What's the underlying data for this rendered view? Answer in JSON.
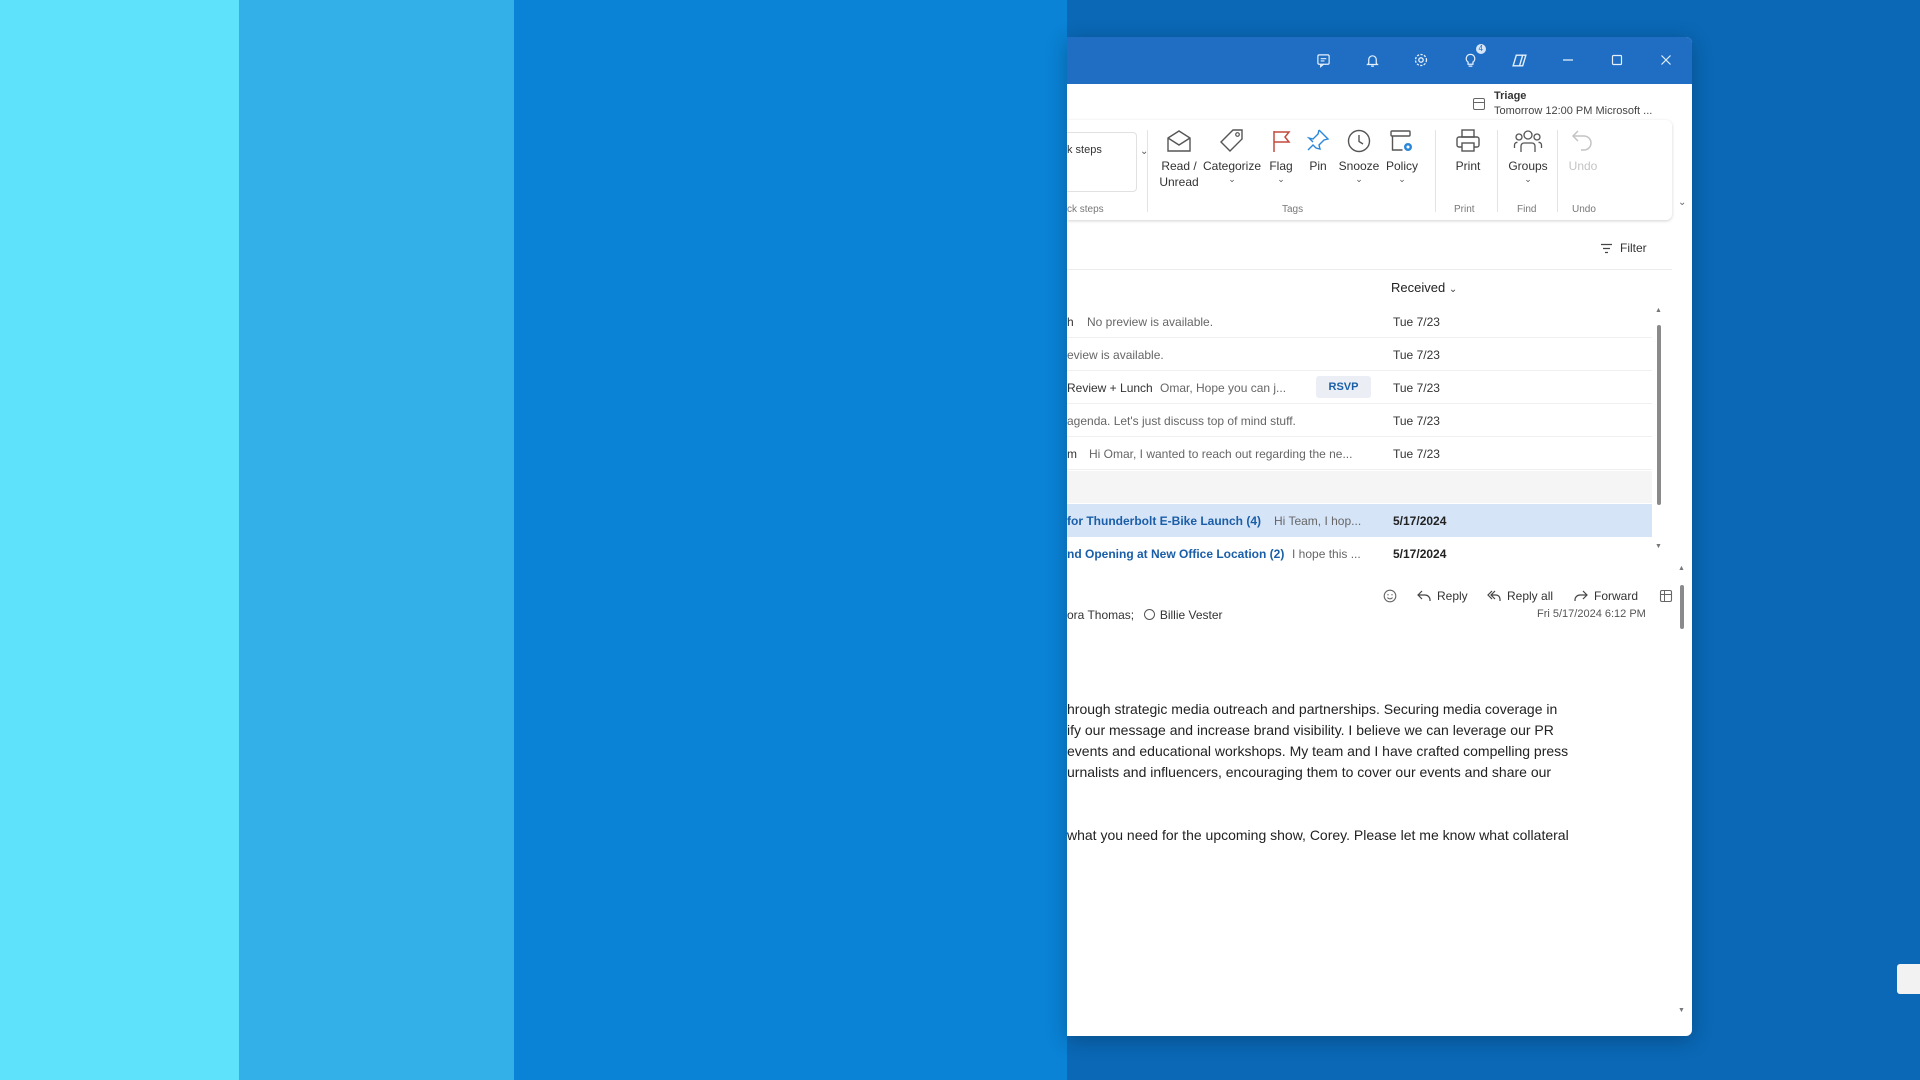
{
  "titlebar": {
    "icons": [
      "notepad-icon",
      "bell-icon",
      "gear-icon",
      "lightbulb-icon",
      "copilot-icon",
      "minimize-icon",
      "maximize-icon",
      "close-icon"
    ],
    "tips_badge": "4"
  },
  "triage": {
    "title": "Triage",
    "detail": "Tomorrow 12:00 PM Microsoft ..."
  },
  "ribbon": {
    "quick_steps_label": "k steps",
    "quick_steps_group": "ck steps",
    "read_unread_line1": "Read /",
    "read_unread_line2": "Unread",
    "categorize": "Categorize",
    "flag": "Flag",
    "pin": "Pin",
    "snooze": "Snooze",
    "policy": "Policy",
    "print": "Print",
    "groups": "Groups",
    "undo": "Undo",
    "groups_labels": {
      "tags": "Tags",
      "print": "Print",
      "find": "Find",
      "undo": "Undo"
    }
  },
  "list": {
    "filter": "Filter",
    "sort_label": "Received",
    "rows": [
      {
        "subject": "h",
        "preview": "No preview is available.",
        "date": "Tue 7/23"
      },
      {
        "subject": "",
        "preview": "eview is available.",
        "date": "Tue 7/23"
      },
      {
        "subject": "Review + Lunch",
        "preview": "Omar, Hope you can j...",
        "date": "Tue 7/23",
        "rsvp": "RSVP"
      },
      {
        "subject": "",
        "preview": "agenda. Let's just discuss top of mind stuff.",
        "date": "Tue 7/23"
      },
      {
        "subject": "m",
        "preview": "Hi Omar, I wanted to reach out regarding the ne...",
        "date": "Tue 7/23"
      },
      {
        "subject": "for Thunderbolt E-Bike Launch (4)",
        "preview": "Hi Team, I hop...",
        "date": "5/17/2024"
      },
      {
        "subject": "nd Opening at New Office Location (2)",
        "preview": "I hope this ...",
        "date": "5/17/2024"
      }
    ]
  },
  "reading": {
    "reply": "Reply",
    "reply_all": "Reply all",
    "forward": "Forward",
    "recipient1": "ora Thomas;",
    "recipient2": "Billie Vester",
    "sent": "Fri 5/17/2024 6:12 PM",
    "body": [
      "hrough strategic media outreach and partnerships. Securing media coverage in",
      "ify our message and increase brand visibility. I believe we can leverage our PR",
      "events and educational workshops. My team and I have crafted compelling press",
      "urnalists and influencers, encouraging them to cover our events and share our",
      "what you need for the upcoming show, Corey. Please let me know what collateral"
    ]
  },
  "colors": {
    "stripe_1": "#5ee2fb",
    "stripe_2": "#33b0e8",
    "stripe_3": "#0a82d5",
    "stripe_4": "#0a68b6",
    "titlebar": "#1f6ec4",
    "selected_row": "#d6e4f8",
    "link_blue": "#1a5ea8"
  }
}
